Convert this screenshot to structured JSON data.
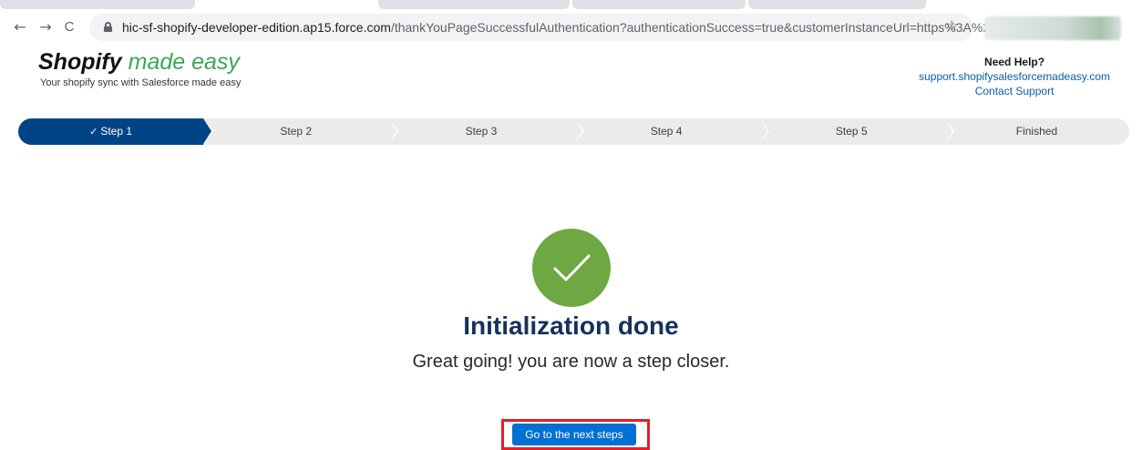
{
  "browser": {
    "url_host": "hic-sf-shopify-developer-edition.ap15.force.com",
    "url_rest": "/thankYouPageSuccessfulAuthentication?authenticationSuccess=true&customerInstanceUrl=https%3A%2F%...",
    "back_icon": "←",
    "forward_icon": "→",
    "reload_icon": "C",
    "star_icon": "☆"
  },
  "header": {
    "brand_bold": "Shopify",
    "brand_light": "made easy",
    "tagline": "Your shopify sync with Salesforce made easy",
    "help_title": "Need Help?",
    "help_site": "support.shopifysalesforcemadeasy.com",
    "help_contact": "Contact Support"
  },
  "path": {
    "steps": [
      {
        "label": "Step 1",
        "status": "complete"
      },
      {
        "label": "Step 2",
        "status": "incomplete"
      },
      {
        "label": "Step 3",
        "status": "incomplete"
      },
      {
        "label": "Step 4",
        "status": "incomplete"
      },
      {
        "label": "Step 5",
        "status": "incomplete"
      },
      {
        "label": "Finished",
        "status": "incomplete"
      }
    ],
    "check_icon": "✓"
  },
  "main": {
    "title": "Initialization done",
    "subtitle": "Great going! you are now a step closer.",
    "next_button": "Go to the next steps"
  },
  "colors": {
    "active_step": "#014486",
    "success": "#6ea843",
    "button": "#0070d2",
    "highlight": "#e21f26",
    "brand_green": "#3aa853"
  }
}
